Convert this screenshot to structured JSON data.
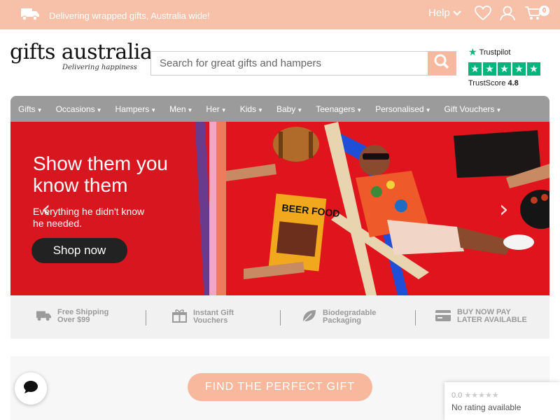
{
  "topbar": {
    "message": "Delivering wrapped gifts, Australia wide!",
    "help_label": "Help",
    "cart_count": "0",
    "icons": [
      "truck-icon",
      "chevron-down-icon",
      "heart-icon",
      "user-icon",
      "cart-icon"
    ]
  },
  "header": {
    "logo_name": "gifts australia",
    "logo_tagline": "Delivering happiness",
    "search_placeholder": "Search for great gifts and hampers",
    "trustpilot": {
      "brand": "Trustpilot",
      "score_label": "TrustScore",
      "score_value": "4.8",
      "stars": 5
    }
  },
  "nav": {
    "items": [
      "Gifts",
      "Occasions",
      "Hampers",
      "Men",
      "Her",
      "Kids",
      "Baby",
      "Teenagers",
      "Personalised",
      "Gift Vouchers"
    ]
  },
  "hero": {
    "headline": "Show them you know them",
    "subtext": "Everything he didn't know he needed.",
    "cta": "Shop now",
    "book_title": "BEER FOOD"
  },
  "usp": [
    {
      "line1": "Free Shipping",
      "line2": "Over $99",
      "icon": "truck-icon"
    },
    {
      "line1": "Instant Gift",
      "line2": "Vouchers",
      "icon": "gift-icon"
    },
    {
      "line1": "Biodegradable",
      "line2": "Packaging",
      "icon": "leaf-icon"
    },
    {
      "line1": "BUY NOW PAY",
      "line2": "LATER AVAILABLE",
      "icon": "credit-card-icon"
    }
  ],
  "finder": {
    "button_label": "FIND THE PERFECT GIFT"
  },
  "rating_widget": {
    "score": "0.0",
    "stars": "★★★★★",
    "label": "No rating available"
  },
  "colors": {
    "accent": "#f7b89d",
    "topbar": "#f7c0a8",
    "nav": "#9b9b9b",
    "hero_red": "#d7161f",
    "trustpilot_green": "#00b67a"
  }
}
